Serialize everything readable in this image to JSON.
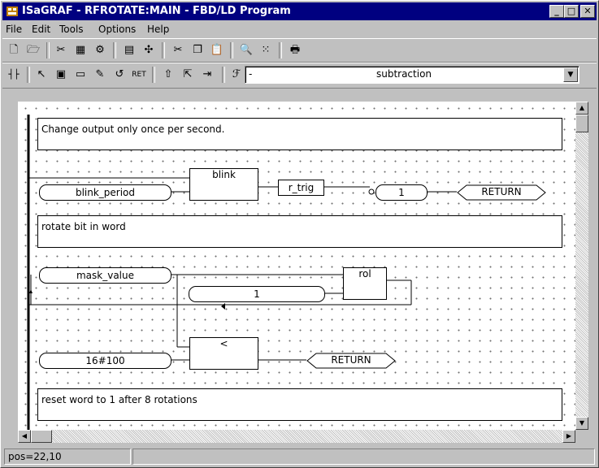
{
  "window": {
    "title": "ISaGRAF - RFROTATE:MAIN - FBD/LD Program",
    "app_icon": "isagraf-app-icon"
  },
  "title_buttons": [
    "_",
    "□",
    "✕"
  ],
  "menu": [
    "File",
    "Edit",
    "Tools",
    "Options",
    "Help"
  ],
  "toolbar1": [
    "new",
    "open",
    "cut",
    "compile",
    "monitor",
    "library",
    "link",
    "scissors",
    "copy",
    "paste",
    "zoom",
    "grid",
    "print"
  ],
  "toolbar2": {
    "combo_prefix": "-",
    "combo_value": "subtraction"
  },
  "diagram": {
    "comments": [
      "Change output only once per second.",
      "rotate bit in word",
      "reset word to 1 after 8 rotations"
    ],
    "vars": {
      "blink_period": "blink_period",
      "one_a": "1",
      "mask_value": "mask_value",
      "one_b": "1",
      "hex100": "16#100"
    },
    "blocks": {
      "blink": "blink",
      "r_trig": "r_trig",
      "rol": "rol",
      "lt": "<"
    },
    "returns": [
      "RETURN",
      "RETURN"
    ]
  },
  "status": {
    "pos": "pos=22,10"
  }
}
